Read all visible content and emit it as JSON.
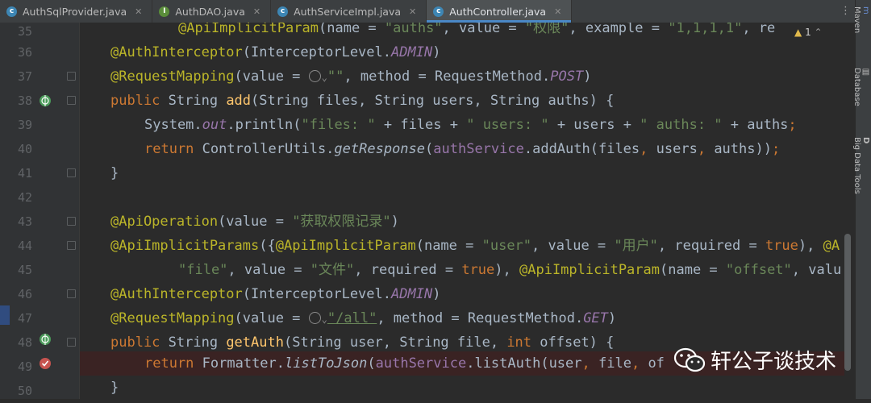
{
  "tabs": [
    {
      "label": "AuthSqlProvider.java",
      "icon": "class-icon",
      "active": false
    },
    {
      "label": "AuthDAO.java",
      "icon": "interface-icon",
      "active": false
    },
    {
      "label": "AuthServiceImpl.java",
      "icon": "class-icon",
      "active": false
    },
    {
      "label": "AuthController.java",
      "icon": "class-icon",
      "active": true
    }
  ],
  "line_numbers": [
    "35",
    "36",
    "37",
    "38",
    "39",
    "40",
    "41",
    "42",
    "43",
    "44",
    "45",
    "46",
    "47",
    "48",
    "49",
    "50"
  ],
  "code": {
    "l35": {
      "ann": "@ApiImplicitParam",
      "a": "(name = ",
      "s1": "\"auths\"",
      "b": ", value = ",
      "s2": "\"权限\"",
      "c": ", example = ",
      "s3": "\"1,1,1,1\"",
      "d": ", re"
    },
    "l36": {
      "ann": "@AuthInterceptor",
      "a": "(InterceptorLevel.",
      "f": "ADMIN",
      "b": ")"
    },
    "l37": {
      "ann": "@RequestMapping",
      "a": "(value = ",
      "s": "\"\"",
      "b": ", method = RequestMethod.",
      "f": "POST",
      "c": ")"
    },
    "l38": {
      "k1": "public ",
      "a": "String ",
      "fn": "add",
      "b": "(String files, String users, String auths) {"
    },
    "l39": {
      "a": "System.",
      "f": "out",
      "b": ".println(",
      "s1": "\"files: \"",
      "c": " + files + ",
      "s2": "\" users: \"",
      "d": " + users + ",
      "s3": "\" auths: \"",
      "e": " + auths",
      "k": ";"
    },
    "l40": {
      "k1": "return ",
      "a": "ControllerUtils.",
      "it": "getResponse",
      "b": "(",
      "f": "authService",
      "c": ".addAuth(files",
      "k2": ",",
      "d": " users",
      "k3": ",",
      "e": " auths))",
      "k4": ";"
    },
    "l41": {
      "a": "}"
    },
    "l43": {
      "ann": "@ApiOperation",
      "a": "(value = ",
      "s": "\"获取权限记录\"",
      "b": ")"
    },
    "l44": {
      "ann": "@ApiImplicitParams",
      "a": "({",
      "ann2": "@ApiImplicitParam",
      "b": "(name = ",
      "s1": "\"user\"",
      "c": ", value = ",
      "s2": "\"用户\"",
      "d": ", required = ",
      "k": "true",
      "e": "), ",
      "ann3": "@A"
    },
    "l45": {
      "s1": "\"file\"",
      "a": ", value = ",
      "s2": "\"文件\"",
      "b": ", required = ",
      "k": "true",
      "c": "), ",
      "ann": "@ApiImplicitParam",
      "d": "(name = ",
      "s3": "\"offset\"",
      "e": ", valu"
    },
    "l46": {
      "ann": "@AuthInterceptor",
      "a": "(InterceptorLevel.",
      "f": "ADMIN",
      "b": ")"
    },
    "l47": {
      "ann": "@RequestMapping",
      "a": "(value = ",
      "s": "\"/all\"",
      "b": ", method = RequestMethod.",
      "f": "GET",
      "c": ")"
    },
    "l48": {
      "k1": "public ",
      "a": "String ",
      "fn": "getAuth",
      "b": "(String user, String file, ",
      "k2": "int",
      "c": " offset) {"
    },
    "l49": {
      "k1": "return ",
      "a": "Formatter.",
      "it": "listToJson",
      "b": "(",
      "f": "authService",
      "c": ".listAuth(user",
      "k2": ",",
      "d": " file",
      "k3": ",",
      "e": " of"
    },
    "l50": {
      "a": "}"
    }
  },
  "inspection_count": "1",
  "right_panels": [
    "Maven",
    "Database",
    "Big Data Tools"
  ],
  "watermark": "轩公子谈技术",
  "colors": {
    "annotation": "#bbb529",
    "string": "#6a8759",
    "keyword": "#cc7832",
    "method": "#ffc66d",
    "field": "#9876aa",
    "text": "#a9b7c6"
  }
}
